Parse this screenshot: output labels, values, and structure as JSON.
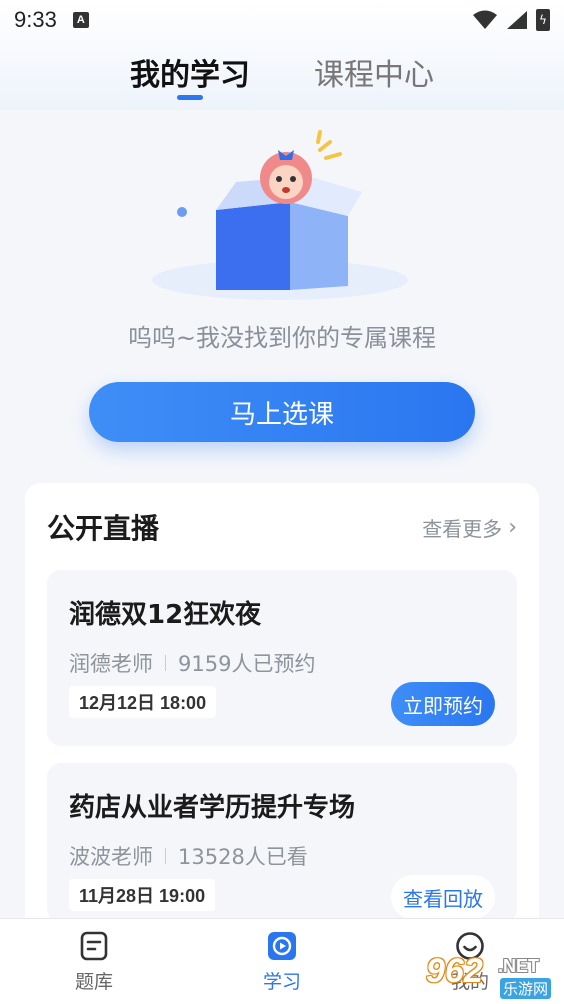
{
  "status_bar": {
    "time": "9:33",
    "notification_badge": "A"
  },
  "tabs": [
    {
      "label": "我的学习",
      "active": true
    },
    {
      "label": "课程中心",
      "active": false
    }
  ],
  "empty_state": {
    "message": "呜呜~我没找到你的专属课程",
    "button_label": "马上选课"
  },
  "live_section": {
    "title": "公开直播",
    "more_label": "查看更多",
    "items": [
      {
        "title": "润德双12狂欢夜",
        "teacher": "润德老师",
        "stat": "9159人已预约",
        "datetime": "12月12日 18:00",
        "action_label": "立即预约"
      },
      {
        "title": "药店从业者学历提升专场",
        "teacher": "波波老师",
        "stat": "13528人已看",
        "datetime": "11月28日 19:00",
        "action_label": "查看回放"
      }
    ]
  },
  "bottom_nav": [
    {
      "label": "题库",
      "icon": "question-bank-icon",
      "active": false
    },
    {
      "label": "学习",
      "icon": "play-study-icon",
      "active": true
    },
    {
      "label": "我的",
      "icon": "smile-profile-icon",
      "active": false
    }
  ],
  "watermark": {
    "number": "962",
    "domain": ".NET",
    "sub": "乐游网"
  },
  "colors": {
    "accent": "#2a76f0",
    "background": "#f4f6fa"
  }
}
